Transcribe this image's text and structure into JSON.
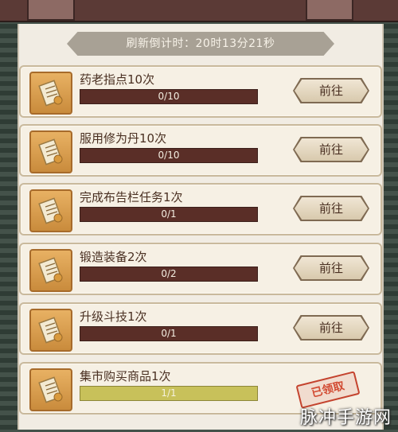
{
  "timer": {
    "text": "刷新倒计时：20时13分21秒"
  },
  "tasks": [
    {
      "title": "药老指点10次",
      "progress_text": "0/10",
      "progress": 0,
      "action": "前往"
    },
    {
      "title": "服用修为丹10次",
      "progress_text": "0/10",
      "progress": 0,
      "action": "前往"
    },
    {
      "title": "完成布告栏任务1次",
      "progress_text": "0/1",
      "progress": 0,
      "action": "前往"
    },
    {
      "title": "锻造装备2次",
      "progress_text": "0/2",
      "progress": 0,
      "action": "前往"
    },
    {
      "title": "升级斗技1次",
      "progress_text": "0/1",
      "progress": 0,
      "action": "前往"
    },
    {
      "title": "集市购买商品1次",
      "progress_text": "1/1",
      "progress": 1,
      "status": "已领取"
    }
  ],
  "icons": {
    "task_icon": "scroll-icon"
  },
  "watermark": "脉冲手游网",
  "colors": {
    "bar_empty": "#5a2e27",
    "bar_full": "#cfc65e",
    "stamp": "#c4432e"
  }
}
